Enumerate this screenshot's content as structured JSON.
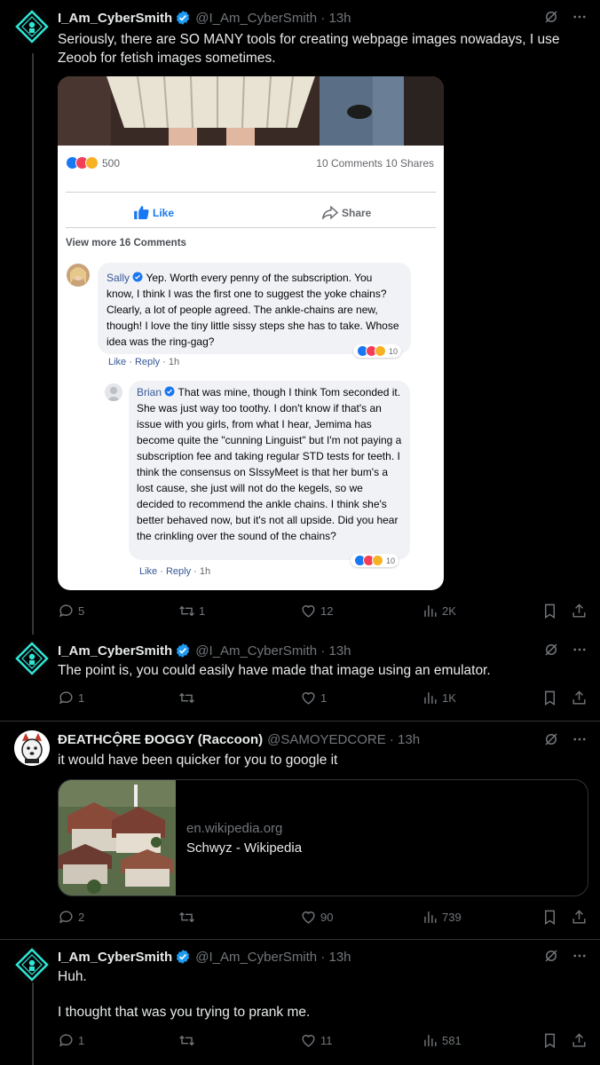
{
  "tweets": [
    {
      "name": "I_Am_CyberSmith",
      "handle": "@I_Am_CyberSmith · 13h",
      "text": "Seriously, there are SO MANY tools for creating webpage images nowadays, I use Zeoob for fetish images sometimes.",
      "replies": "5",
      "retweets": "1",
      "likes": "12",
      "views": "2K"
    },
    {
      "name": "I_Am_CyberSmith",
      "handle": "@I_Am_CyberSmith · 13h",
      "text": "The point is, you could easily have made that image using an emulator.",
      "replies": "1",
      "retweets": "",
      "likes": "1",
      "views": "1K"
    },
    {
      "name": "ĐEATHCỘRE ĐOGGY (Raccoon)",
      "handle": "@SAMOYEDCORE · 13h",
      "text": "it would have been quicker for you to google it",
      "replies": "2",
      "retweets": "",
      "likes": "90",
      "views": "739"
    },
    {
      "name": "I_Am_CyberSmith",
      "handle": "@I_Am_CyberSmith · 13h",
      "text1": "Huh.",
      "text2": "I thought that was you trying to prank me.",
      "replies": "1",
      "retweets": "",
      "likes": "11",
      "views": "581"
    }
  ],
  "fb_card": {
    "reaction_count": "500",
    "comments_shares": "10 Comments 10 Shares",
    "like_label": "Like",
    "share_label": "Share",
    "view_more": "View more 16 Comments",
    "comment1": {
      "author": "Sally",
      "text": "Yep. Worth every penny of the subscription. You know, I think I was the first one to suggest the yoke chains? Clearly, a lot of people agreed. The ankle-chains are new, though! I love the tiny little sissy steps she has to take. Whose idea was the ring-gag?",
      "like": "Like",
      "reply": "Reply",
      "time": "1h",
      "count": "10"
    },
    "comment2": {
      "author": "Brian",
      "text": "That was mine, though I think Tom seconded it. She was just way too toothy. I don't know if that's an issue with you girls, from what I hear, Jemima has become quite the \"cunning Linguist\" but I'm not paying a subscription fee and taking regular STD tests for teeth. I think the consensus on SIssyMeet is that her bum's a lost cause, she just will not do the kegels, so we decided to recommend the ankle chains. I think she's better behaved now, but it's not all upside. Did you hear the crinkling over the sound of the chains?",
      "like": "Like",
      "reply": "Reply",
      "time": "1h",
      "count": "10"
    }
  },
  "link_card": {
    "domain": "en.wikipedia.org",
    "title": "Schwyz - Wikipedia"
  },
  "colors": {
    "background": "#000000",
    "text": "#e7e9ea",
    "muted": "#71767b",
    "verified": "#1d9bf0",
    "cyber_accent": "#2ee6d6"
  }
}
